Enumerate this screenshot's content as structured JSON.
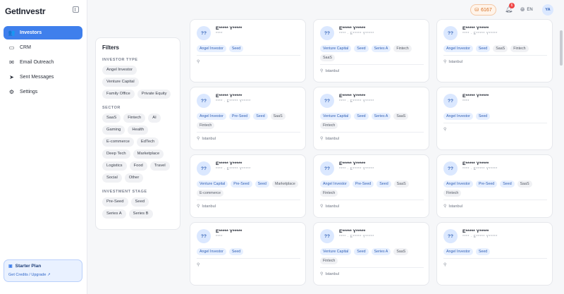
{
  "app": {
    "logo": "GetInvestr"
  },
  "sidebar": {
    "items": [
      {
        "label": "Investors",
        "icon": "👥"
      },
      {
        "label": "CRM",
        "icon": "▭"
      },
      {
        "label": "Email Outreach",
        "icon": "✉"
      },
      {
        "label": "Sent Messages",
        "icon": "➤"
      },
      {
        "label": "Settings",
        "icon": "⚙"
      }
    ],
    "plan": {
      "title": "Starter Plan",
      "link": "Get Credits / Upgrade ↗"
    }
  },
  "header": {
    "credits": "6167",
    "notifications": "6",
    "language": "EN",
    "user_initials": "YA"
  },
  "filters": {
    "title": "Filters",
    "investor_type": {
      "title": "INVESTOR TYPE",
      "options": [
        "Angel Investor",
        "Venture Capital",
        "Family Office",
        "Private Equity"
      ]
    },
    "sector": {
      "title": "SECTOR",
      "options": [
        "SaaS",
        "Fintech",
        "AI",
        "Gaming",
        "Health",
        "E-commerce",
        "EdTech",
        "Deep Tech",
        "Marketplace",
        "Logistics",
        "Food",
        "Travel",
        "Social",
        "Other"
      ]
    },
    "stage": {
      "title": "INVESTMENT STAGE",
      "options": [
        "Pre-Seed",
        "Seed",
        "Series A",
        "Series B"
      ]
    }
  },
  "cards": [
    {
      "avatar": "??",
      "name": "E***** Y*****",
      "sub": "****",
      "tags": [
        [
          "Angel Investor",
          "blue"
        ],
        [
          "Seed",
          "blue"
        ]
      ],
      "location": ""
    },
    {
      "avatar": "??",
      "name": "E***** Y*****",
      "sub": "**** · E***** Y*****",
      "tags": [
        [
          "Venture Capital",
          "blue"
        ],
        [
          "Seed",
          "blue"
        ],
        [
          "Series A",
          "blue"
        ],
        [
          "Fintech",
          "gray"
        ],
        [
          "SaaS",
          "gray"
        ]
      ],
      "location": "Istanbul"
    },
    {
      "avatar": "??",
      "name": "E***** Y*****",
      "sub": "**** · E***** Y*****",
      "tags": [
        [
          "Angel Investor",
          "blue"
        ],
        [
          "Seed",
          "blue"
        ],
        [
          "SaaS",
          "gray"
        ],
        [
          "Fintech",
          "gray"
        ]
      ],
      "location": "Istanbul"
    },
    {
      "avatar": "??",
      "name": "E***** Y*****",
      "sub": "**** · E***** Y*****",
      "tags": [
        [
          "Angel Investor",
          "blue"
        ],
        [
          "Pre-Seed",
          "blue"
        ],
        [
          "Seed",
          "blue"
        ],
        [
          "SaaS",
          "gray"
        ],
        [
          "Fintech",
          "gray"
        ]
      ],
      "location": "Istanbul"
    },
    {
      "avatar": "??",
      "name": "E***** Y*****",
      "sub": "**** · E***** Y*****",
      "tags": [
        [
          "Venture Capital",
          "blue"
        ],
        [
          "Seed",
          "blue"
        ],
        [
          "Series A",
          "blue"
        ],
        [
          "SaaS",
          "gray"
        ],
        [
          "Fintech",
          "gray"
        ]
      ],
      "location": "Istanbul"
    },
    {
      "avatar": "??",
      "name": "E***** Y*****",
      "sub": "****",
      "tags": [
        [
          "Angel Investor",
          "blue"
        ],
        [
          "Seed",
          "blue"
        ]
      ],
      "location": ""
    },
    {
      "avatar": "??",
      "name": "E***** Y*****",
      "sub": "**** · E***** Y*****",
      "tags": [
        [
          "Venture Capital",
          "blue"
        ],
        [
          "Pre-Seed",
          "blue"
        ],
        [
          "Seed",
          "blue"
        ],
        [
          "Marketplace",
          "gray"
        ],
        [
          "E-commerce",
          "gray"
        ]
      ],
      "location": "Istanbul"
    },
    {
      "avatar": "??",
      "name": "E***** Y*****",
      "sub": "**** · E***** Y*****",
      "tags": [
        [
          "Angel Investor",
          "blue"
        ],
        [
          "Pre-Seed",
          "blue"
        ],
        [
          "Seed",
          "blue"
        ],
        [
          "SaaS",
          "gray"
        ],
        [
          "Fintech",
          "gray"
        ]
      ],
      "location": "Istanbul"
    },
    {
      "avatar": "??",
      "name": "E***** Y*****",
      "sub": "**** · E***** Y*****",
      "tags": [
        [
          "Angel Investor",
          "blue"
        ],
        [
          "Pre-Seed",
          "blue"
        ],
        [
          "Seed",
          "blue"
        ],
        [
          "SaaS",
          "gray"
        ],
        [
          "Fintech",
          "gray"
        ]
      ],
      "location": "Istanbul"
    },
    {
      "avatar": "??",
      "name": "E***** Y*****",
      "sub": "****",
      "tags": [
        [
          "Angel Investor",
          "blue"
        ],
        [
          "Seed",
          "blue"
        ]
      ],
      "location": ""
    },
    {
      "avatar": "??",
      "name": "E***** Y*****",
      "sub": "**** · E***** Y*****",
      "tags": [
        [
          "Venture Capital",
          "blue"
        ],
        [
          "Seed",
          "blue"
        ],
        [
          "Series A",
          "blue"
        ],
        [
          "SaaS",
          "gray"
        ],
        [
          "Fintech",
          "gray"
        ]
      ],
      "location": "Istanbul"
    },
    {
      "avatar": "??",
      "name": "E***** Y*****",
      "sub": "**** · E***** Y*****",
      "tags": [
        [
          "Angel Investor",
          "blue"
        ],
        [
          "Seed",
          "blue"
        ]
      ],
      "location": ""
    }
  ]
}
